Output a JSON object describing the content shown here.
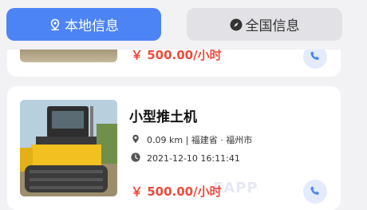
{
  "tabs": {
    "local": "本地信息",
    "national": "全国信息"
  },
  "listings": [
    {
      "price": "￥ 500.00/小时"
    },
    {
      "title": "小型推土机",
      "location": "0.09 km | 福建省 · 福州市",
      "time": "2021-12-10 16:11:41",
      "price": "￥ 500.00/小时",
      "watermark": "EAPP"
    }
  ],
  "colors": {
    "accent": "#4c84f6",
    "price": "#ee4b3b"
  }
}
